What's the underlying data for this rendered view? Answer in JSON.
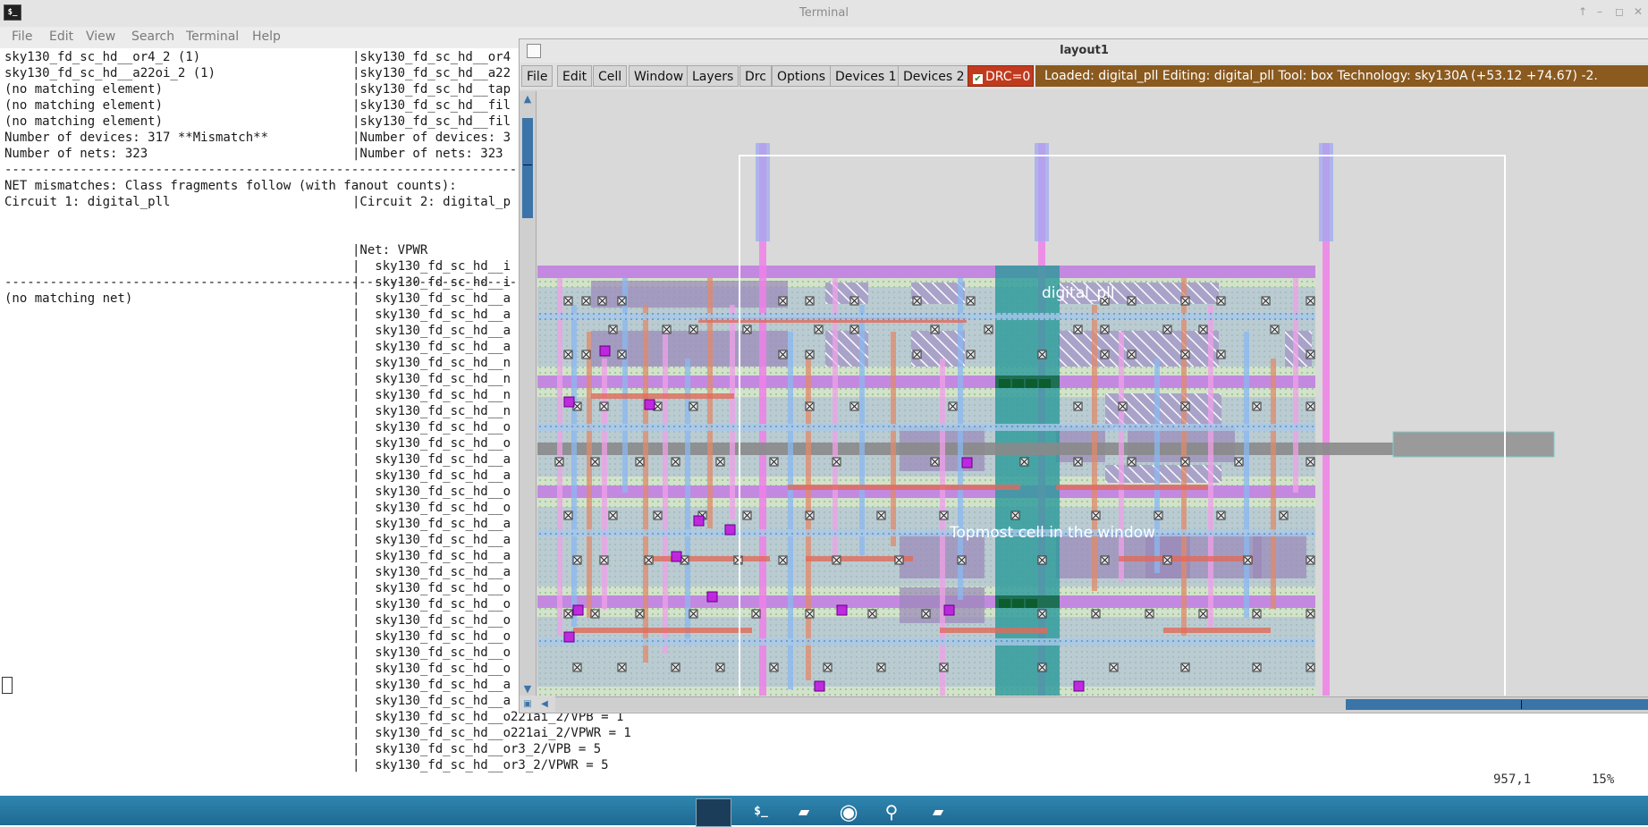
{
  "terminal": {
    "title": "Terminal",
    "menu": [
      "File",
      "Edit",
      "View",
      "Search",
      "Terminal",
      "Help"
    ],
    "left_lines": [
      "sky130_fd_sc_hd__or4_2 (1)",
      "sky130_fd_sc_hd__a22oi_2 (1)",
      "(no matching element)",
      "(no matching element)",
      "(no matching element)",
      "Number of devices: 317 **Mismatch**",
      "Number of nets: 323",
      "---------------------------------------------------------------------------------------",
      "NET mismatches: Class fragments follow (with fanout counts):",
      "Circuit 1: digital_pll",
      "",
      "---------------------------------------------------------------------------------------",
      "(no matching net)"
    ],
    "right_lines": [
      "|sky130_fd_sc_hd__or4",
      "|sky130_fd_sc_hd__a22",
      "|sky130_fd_sc_hd__tap",
      "|sky130_fd_sc_hd__fil",
      "|sky130_fd_sc_hd__fil",
      "|Number of devices: 3",
      "|Number of nets: 323",
      "",
      "",
      "|Circuit 2: digital_p",
      "",
      "",
      "|Net: VPWR",
      "|  sky130_fd_sc_hd__i",
      "|  sky130_fd_sc_hd__i",
      "|  sky130_fd_sc_hd__a",
      "|  sky130_fd_sc_hd__a",
      "|  sky130_fd_sc_hd__a",
      "|  sky130_fd_sc_hd__a",
      "|  sky130_fd_sc_hd__n",
      "|  sky130_fd_sc_hd__n",
      "|  sky130_fd_sc_hd__n",
      "|  sky130_fd_sc_hd__n",
      "|  sky130_fd_sc_hd__o",
      "|  sky130_fd_sc_hd__o",
      "|  sky130_fd_sc_hd__a",
      "|  sky130_fd_sc_hd__a",
      "|  sky130_fd_sc_hd__o",
      "|  sky130_fd_sc_hd__o",
      "|  sky130_fd_sc_hd__a",
      "|  sky130_fd_sc_hd__a",
      "|  sky130_fd_sc_hd__a",
      "|  sky130_fd_sc_hd__a",
      "|  sky130_fd_sc_hd__o",
      "|  sky130_fd_sc_hd__o",
      "|  sky130_fd_sc_hd__o",
      "|  sky130_fd_sc_hd__o",
      "|  sky130_fd_sc_hd__o",
      "|  sky130_fd_sc_hd__o",
      "|  sky130_fd_sc_hd__a",
      "|  sky130_fd_sc_hd__a",
      "|  sky130_fd_sc_hd__o221ai_2/VPB = 1",
      "|  sky130_fd_sc_hd__o221ai_2/VPWR = 1",
      "|  sky130_fd_sc_hd__or3_2/VPB = 5",
      "|  sky130_fd_sc_hd__or3_2/VPWR = 5"
    ],
    "status_position": "957,1",
    "status_percent": "15%"
  },
  "magic": {
    "title": "layout1",
    "menu": [
      "File",
      "Edit",
      "Cell",
      "Window",
      "Layers",
      "Drc",
      "Options",
      "Devices 1",
      "Devices 2"
    ],
    "drc_label": "DRC=0",
    "drc_checked": true,
    "status": "Loaded: digital_pll Editing: digital_pll Tool: box  Technology: sky130A",
    "coordinates": "(+53.12 +74.67) -2.",
    "cell_name": "digital_pll",
    "topmost_label": "Topmost cell in the window"
  },
  "taskbar": {
    "icons": [
      "desktop-icon",
      "terminal-icon",
      "folder-icon",
      "browser-icon",
      "search-icon",
      "files-icon"
    ]
  },
  "colors": {
    "drc_bg": "#c23a1d",
    "status_bg": "#8a5a1f",
    "taskbar": "#2a7fae",
    "scroll_thumb": "#3a74a8"
  }
}
